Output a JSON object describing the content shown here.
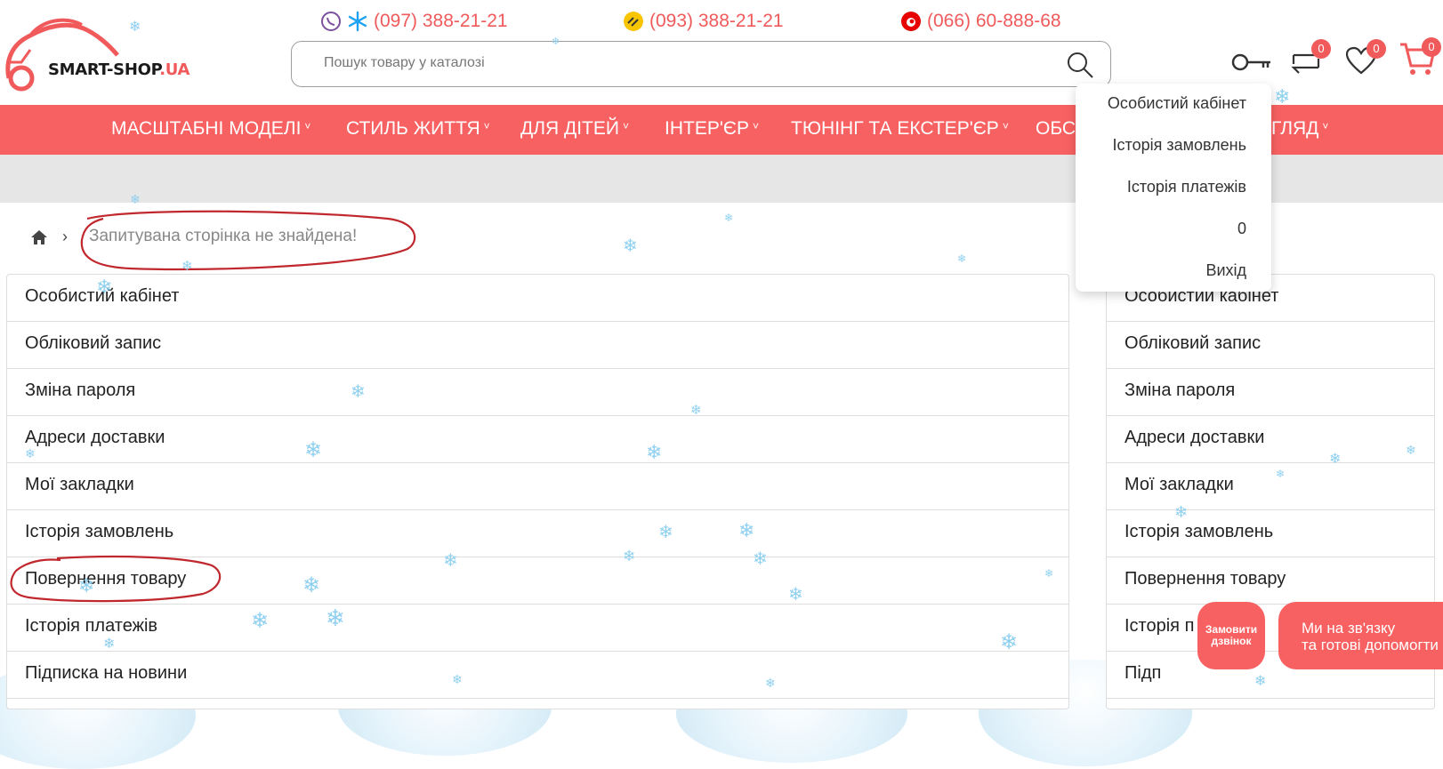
{
  "header": {
    "logo_text_main": "SMART-SHOP",
    "logo_text_suffix": ".UA",
    "phones": [
      {
        "number": "(097) 388-21-21",
        "icon": "viber-kyivstar-icon"
      },
      {
        "number": "(093) 388-21-21",
        "icon": "lifecell-icon"
      },
      {
        "number": "(066) 60-888-68",
        "icon": "vodafone-icon"
      }
    ],
    "search_placeholder": "Пошук товару у каталозі",
    "compare_count": "0",
    "wishlist_count": "0",
    "cart_count": "0"
  },
  "nav": {
    "items": [
      {
        "label": "МАСШТАБНІ МОДЕЛІ"
      },
      {
        "label": "СТИЛЬ ЖИТТЯ"
      },
      {
        "label": "ДЛЯ ДІТЕЙ"
      },
      {
        "label": "ІНТЕР'ЄР"
      },
      {
        "label": "ТЮНІНГ ТА ЕКСТЕР'ЄР"
      },
      {
        "label": "ОБС"
      },
      {
        "label": "ГЛЯД"
      }
    ]
  },
  "breadcrumb": {
    "current": "Запитувана сторінка не знайдена!"
  },
  "account_menu": {
    "items": [
      "Особистий кабінет",
      "Обліковий запис",
      "Зміна пароля",
      "Адреси доставки",
      "Мої закладки",
      "Історія замовлень",
      "Повернення товару",
      "Історія платежів",
      "Підписка на новини"
    ]
  },
  "side_menu": {
    "items": [
      "Особистий кабінет",
      "Обліковий запис",
      "Зміна пароля",
      "Адреси доставки",
      "Мої закладки",
      "Історія замовлень",
      "Повернення товару",
      "Історія п",
      "Підп"
    ]
  },
  "dropdown": {
    "items": [
      "Особистий кабінет",
      "Історія замовлень",
      "Історія платежів",
      "0",
      "Вихід"
    ]
  },
  "floating": {
    "callback_line1": "Замовити",
    "callback_line2": "дзвінок",
    "contact_line1": "Ми на зв'язку",
    "contact_line2": "та готові допомогти"
  },
  "colors": {
    "brand": "#f86161",
    "annotation": "#c0282d",
    "snow": "#8fd0f0"
  }
}
